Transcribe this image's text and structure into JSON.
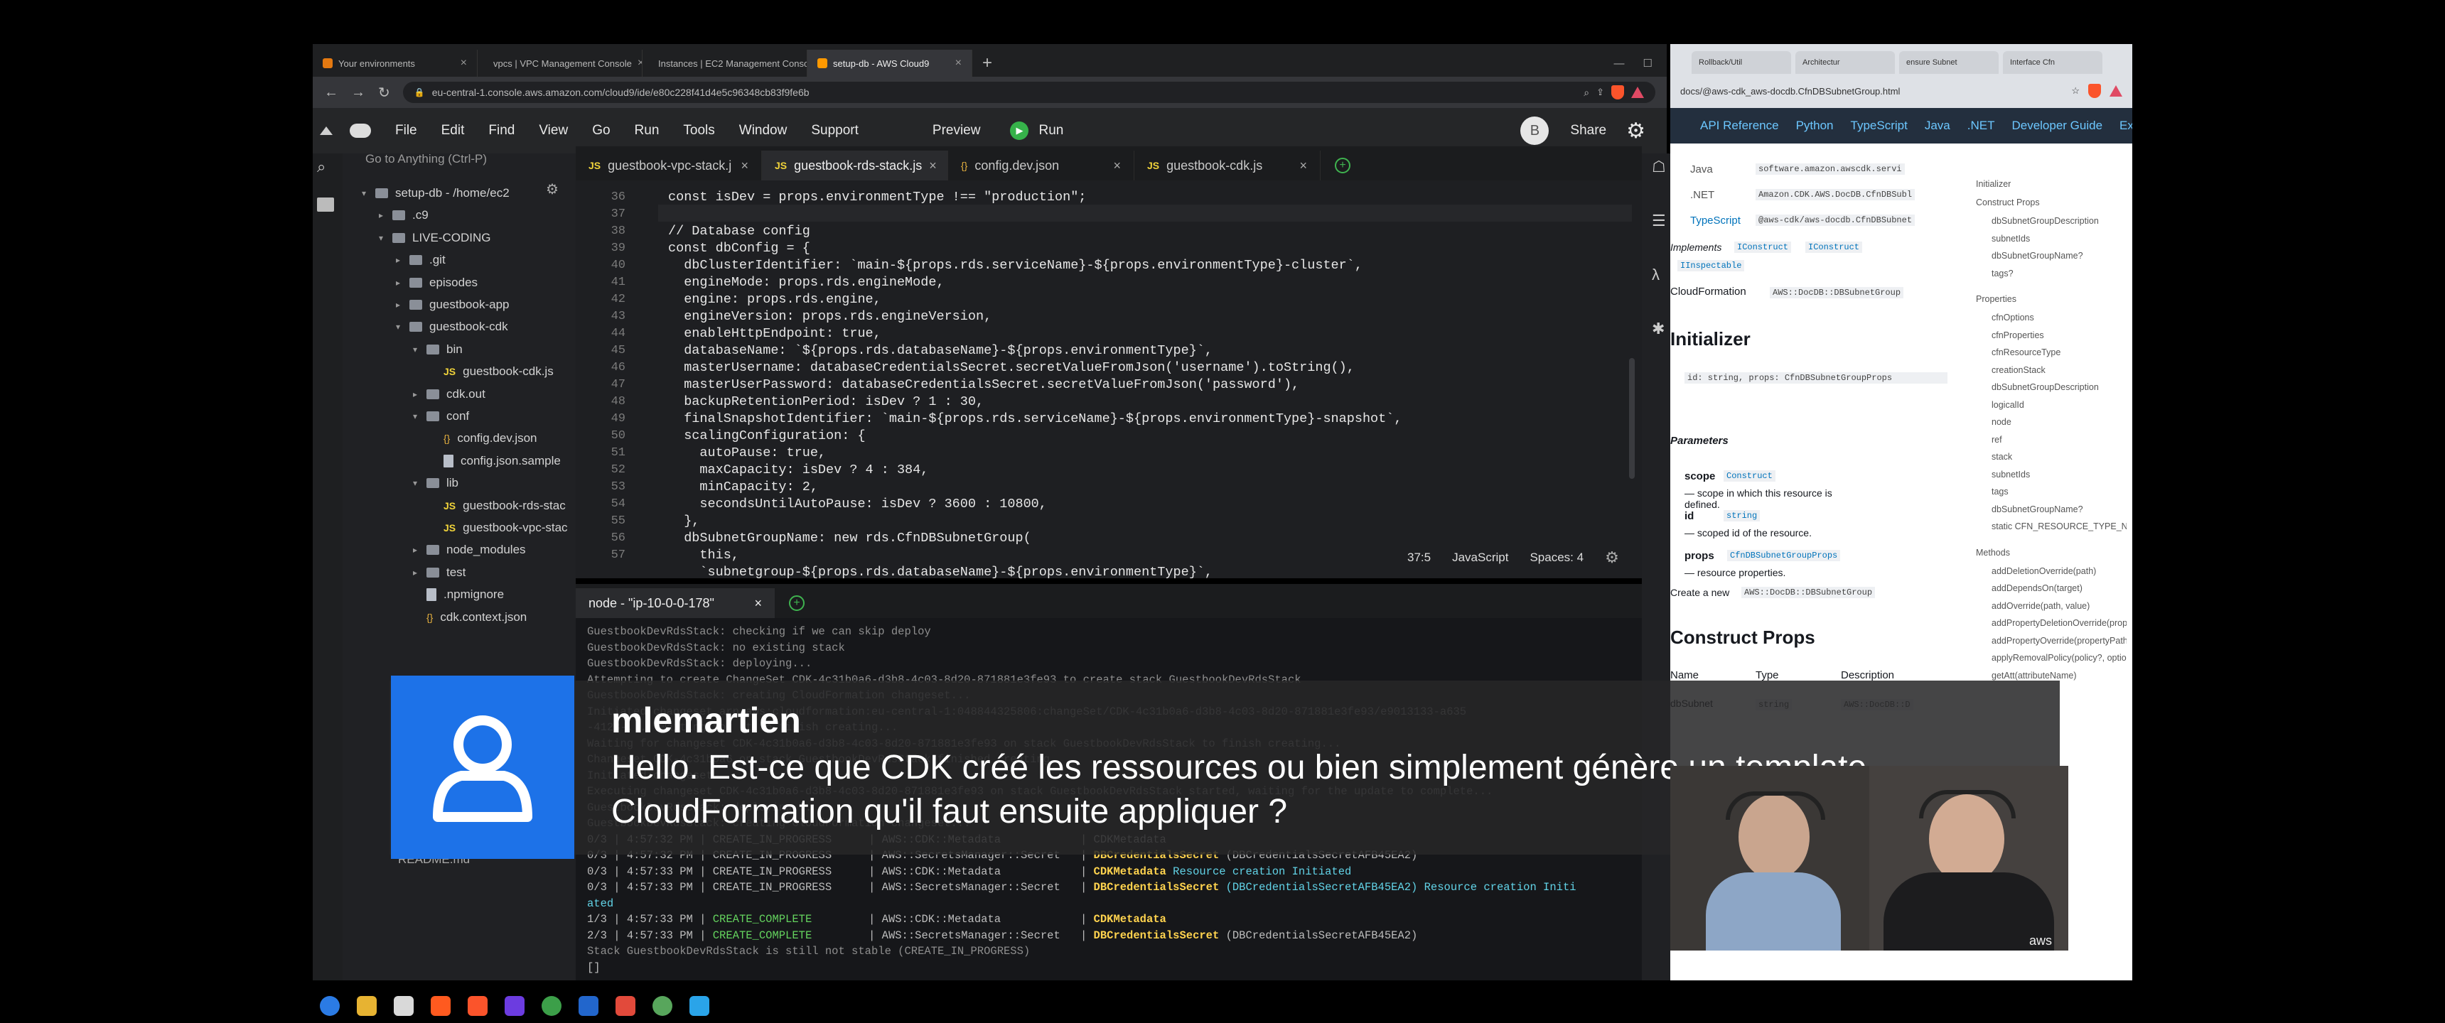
{
  "browser": {
    "tabs": [
      {
        "label": "Your environments",
        "active": false
      },
      {
        "label": "vpcs | VPC Management Console",
        "active": false
      },
      {
        "label": "Instances | EC2 Management Conso",
        "active": false
      },
      {
        "label": "setup-db - AWS Cloud9",
        "active": true
      }
    ],
    "url": "eu-central-1.console.aws.amazon.com/cloud9/ide/e80c228f41d4e5c96348cb83f9fe6b"
  },
  "c9": {
    "menu": [
      "File",
      "Edit",
      "Find",
      "View",
      "Go",
      "Run",
      "Tools",
      "Window",
      "Support"
    ],
    "preview": "Preview",
    "run": "Run",
    "user_initial": "B",
    "share": "Share"
  },
  "tree": {
    "goto_placeholder": "Go to Anything (Ctrl-P)",
    "items": [
      {
        "label": "setup-db - /home/ec2",
        "type": "folder",
        "depth": 0,
        "open": true
      },
      {
        "label": ".c9",
        "type": "folder",
        "depth": 1,
        "open": false
      },
      {
        "label": "LIVE-CODING",
        "type": "folder",
        "depth": 1,
        "open": true
      },
      {
        "label": ".git",
        "type": "folder",
        "depth": 2,
        "open": false
      },
      {
        "label": "episodes",
        "type": "folder",
        "depth": 2,
        "open": false
      },
      {
        "label": "guestbook-app",
        "type": "folder",
        "depth": 2,
        "open": false
      },
      {
        "label": "guestbook-cdk",
        "type": "folder",
        "depth": 2,
        "open": true
      },
      {
        "label": "bin",
        "type": "folder",
        "depth": 3,
        "open": true
      },
      {
        "label": "guestbook-cdk.js",
        "type": "js",
        "depth": 4
      },
      {
        "label": "cdk.out",
        "type": "folder",
        "depth": 3,
        "open": false
      },
      {
        "label": "conf",
        "type": "folder",
        "depth": 3,
        "open": true
      },
      {
        "label": "config.dev.json",
        "type": "json",
        "depth": 4
      },
      {
        "label": "config.json.sample",
        "type": "file",
        "depth": 4
      },
      {
        "label": "lib",
        "type": "folder",
        "depth": 3,
        "open": true
      },
      {
        "label": "guestbook-rds-stac",
        "type": "js",
        "depth": 4
      },
      {
        "label": "guestbook-vpc-stac",
        "type": "js",
        "depth": 4
      },
      {
        "label": "node_modules",
        "type": "folder",
        "depth": 3,
        "open": false
      },
      {
        "label": "test",
        "type": "folder",
        "depth": 3,
        "open": false
      },
      {
        "label": ".npmignore",
        "type": "file",
        "depth": 3
      },
      {
        "label": "cdk.context.json",
        "type": "json",
        "depth": 3
      }
    ],
    "bottom_item": "README.md"
  },
  "editor": {
    "tabs": [
      {
        "label": "guestbook-vpc-stack.j",
        "icon": "JS",
        "active": false
      },
      {
        "label": "guestbook-rds-stack.js",
        "icon": "JS",
        "active": true
      },
      {
        "label": "config.dev.json",
        "icon": "{}",
        "active": false
      },
      {
        "label": "guestbook-cdk.js",
        "icon": "JS",
        "active": false
      }
    ],
    "line_numbers": [
      "36",
      "37",
      "38",
      "39",
      "40",
      "41",
      "42",
      "43",
      "44",
      "45",
      "46",
      "47",
      "48",
      "49",
      "50",
      "51",
      "52",
      "53",
      "54",
      "55",
      "56",
      "57"
    ],
    "lines": [
      "const isDev = props.environmentType !== \"production\";",
      "",
      "// Database config",
      "const dbConfig = {",
      "  dbClusterIdentifier: `main-${props.rds.serviceName}-${props.environmentType}-cluster`,",
      "  engineMode: props.rds.engineMode,",
      "  engine: props.rds.engine,",
      "  engineVersion: props.rds.engineVersion,",
      "  enableHttpEndpoint: true,",
      "  databaseName: `${props.rds.databaseName}-${props.environmentType}`,",
      "  masterUsername: databaseCredentialsSecret.secretValueFromJson('username').toString(),",
      "  masterUserPassword: databaseCredentialsSecret.secretValueFromJson('password'),",
      "  backupRetentionPeriod: isDev ? 1 : 30,",
      "  finalSnapshotIdentifier: `main-${props.rds.serviceName}-${props.environmentType}-snapshot`,",
      "  scalingConfiguration: {",
      "    autoPause: true,",
      "    maxCapacity: isDev ? 4 : 384,",
      "    minCapacity: 2,",
      "    secondsUntilAutoPause: isDev ? 3600 : 10800,",
      "  },",
      "  dbSubnetGroupName: new rds.CfnDBSubnetGroup(",
      "    this,",
      "    `subnetgroup-${props.rds.databaseName}-${props.environmentType}`,"
    ],
    "status": {
      "position": "37:5",
      "language": "JavaScript",
      "spaces": "Spaces: 4"
    }
  },
  "terminal": {
    "tab": "node - \"ip-10-0-0-178\"",
    "lines": [
      {
        "text": "GuestbookDevRdsStack: checking if we can skip deploy",
        "cls": "tc-dim"
      },
      {
        "text": "GuestbookDevRdsStack: no existing stack",
        "cls": "tc-dim"
      },
      {
        "text": "GuestbookDevRdsStack: deploying...",
        "cls": "tc-dim"
      },
      {
        "text": "Attempting to create ChangeSet CDK-4c31b0a6-d3b8-4c03-8d20-871881e3fe93 to create stack GuestbookDevRdsStack",
        "cls": "tc-dim"
      },
      {
        "text": "GuestbookDevRdsStack: creating CloudFormation changeset...",
        "cls": "tc-dim"
      },
      {
        "text": "Initiated changeset arn:aws:cloudformation:eu-central-1:048844325806:changeSet/CDK-4c31b0a6-d3b8-4c03-8d20-871881e3fe93/e9013133-a635",
        "cls": "tc-dim"
      },
      {
        "text": "-4128-...  Waiting for it to finish creating...",
        "cls": "tc-dim"
      },
      {
        "text": "Waiting for changeset CDK-4c31b0a6-d3b8-4c03-8d20-871881e3fe93 on stack GuestbookDevRdsStack to finish creating...",
        "cls": "tc-dim"
      },
      {
        "text": "Changeset CDK-4c31b0a6 on stack GuestbookDevRdsStack finished creating",
        "cls": "tc-dim"
      },
      {
        "text": "Initiated changeset",
        "cls": "tc-dim"
      },
      {
        "text": "Executing changeset CDK-4c31b0a6-d3b8-4c03-8d20-871881e3fe93 on stack GuestbookDevRdsStack started, waiting for the update to complete...",
        "cls": "tc-dim"
      },
      {
        "text": "GuestbookDevRdsStack: deploying...",
        "cls": "tc-dim"
      },
      {
        "text": "GuestbookDevRdsStack: creating CloudFormation changeset...",
        "cls": "tc-dim"
      }
    ],
    "events": [
      {
        "count": "0/3",
        "time": "4:57:32 PM",
        "status": "CREATE_IN_PROGRESS",
        "type": "AWS::CDK::Metadata",
        "id": "CDKMetadata",
        "extra": "",
        "status_cls": "",
        "id_cls": ""
      },
      {
        "count": "0/3",
        "time": "4:57:32 PM",
        "status": "CREATE_IN_PROGRESS",
        "type": "AWS::SecretsManager::Secret",
        "id": "DBCredentialsSecret",
        "extra": " (DBCredentialsSecretAFB45EA2)",
        "status_cls": "",
        "id_cls": "tc-yellow"
      },
      {
        "count": "0/3",
        "time": "4:57:33 PM",
        "status": "CREATE_IN_PROGRESS",
        "type": "AWS::CDK::Metadata",
        "id": "CDKMetadata",
        "extra": " Resource creation Initiated",
        "status_cls": "",
        "id_cls": "tc-yellow"
      },
      {
        "count": "0/3",
        "time": "4:57:33 PM",
        "status": "CREATE_IN_PROGRESS",
        "type": "AWS::SecretsManager::Secret",
        "id": "DBCredentialsSecret",
        "extra": " (DBCredentialsSecretAFB45EA2) Resource creation Initi",
        "status_cls": "",
        "id_cls": "tc-yellow"
      },
      {
        "count": "",
        "time": "",
        "status": "",
        "type": "",
        "id": "",
        "extra": "ated",
        "status_cls": "",
        "id_cls": ""
      },
      {
        "count": "1/3",
        "time": "4:57:33 PM",
        "status": "CREATE_COMPLETE",
        "type": "AWS::CDK::Metadata",
        "id": "CDKMetadata",
        "extra": "",
        "status_cls": "tc-green",
        "id_cls": "tc-yellow"
      },
      {
        "count": "2/3",
        "time": "4:57:33 PM",
        "status": "CREATE_COMPLETE",
        "type": "AWS::SecretsManager::Secret",
        "id": "DBCredentialsSecret",
        "extra": " (DBCredentialsSecretAFB45EA2)",
        "status_cls": "tc-green",
        "id_cls": "tc-yellow"
      }
    ],
    "footer": "Stack GuestbookDevRdsStack is still not stable (CREATE_IN_PROGRESS)",
    "prompt": "[]"
  },
  "docs": {
    "tabs": [
      "Rollback/Util",
      "Architectur",
      "ensure Subnet",
      "Interface Cfn"
    ],
    "url": "docs/@aws-cdk_aws-docdb.CfnDBSubnetGroup.html",
    "nav": [
      "API Reference",
      "Python",
      "TypeScript",
      "Java",
      ".NET",
      "Developer Guide",
      "Examp"
    ],
    "lang_rows": [
      {
        "lang": "Java",
        "pkg": "software.amazon.awscdk.servi"
      },
      {
        "lang": ".NET",
        "pkg": "Amazon.CDK.AWS.DocDB.CfnDBSubl"
      },
      {
        "lang": "TypeScript",
        "pkg": "@aws-cdk/aws-docdb.CfnDBSubnet"
      }
    ],
    "implements_label": "Implements",
    "implements": [
      "IConstruct",
      "IConstruct",
      "IInspectable"
    ],
    "cfn_label": "CloudFormation",
    "cfn_value": "AWS::DocDB::DBSubnetGroup",
    "initializer_title": "Initializer",
    "initializer_sig": "id: string, props: CfnDBSubnetGroupProps",
    "parameters_title": "Parameters",
    "params": [
      {
        "name": "scope",
        "type": "Construct",
        "desc": "— scope in which this resource is defined."
      },
      {
        "name": "id",
        "type": "string",
        "desc": "— scoped id of the resource."
      },
      {
        "name": "props",
        "type": "CfnDBSubnetGroupProps",
        "desc": "— resource properties."
      }
    ],
    "create_text": "Create a new",
    "create_value": "AWS::DocDB::DBSubnetGroup",
    "construct_props_title": "Construct Props",
    "table_headers": [
      "Name",
      "Type",
      "Description"
    ],
    "table_row": {
      "name": "dbSubnet",
      "type": "string",
      "desc": "AWS::DocDB::D"
    },
    "footer": "SubnetGroupDescription",
    "toc": {
      "top": "Initializer",
      "sections": [
        {
          "title": "Construct Props",
          "items": [
            "dbSubnetGroupDescription",
            "subnetIds",
            "dbSubnetGroupName?",
            "tags?"
          ]
        },
        {
          "title": "Properties",
          "items": [
            "cfnOptions",
            "cfnProperties",
            "cfnResourceType",
            "creationStack",
            "dbSubnetGroupDescription",
            "logicalId",
            "node",
            "ref",
            "stack",
            "subnetIds",
            "tags",
            "dbSubnetGroupName?",
            "static CFN_RESOURCE_TYPE_NAME"
          ]
        },
        {
          "title": "Methods",
          "items": [
            "addDeletionOverride(path)",
            "addDependsOn(target)",
            "addOverride(path, value)",
            "addPropertyDeletionOverride(propertyPath)",
            "addPropertyOverride(propertyPath, value)",
            "applyRemovalPolicy(policy?, options?)",
            "getAtt(attributeName)"
          ]
        }
      ]
    }
  },
  "overlay": {
    "username": "mlemartien",
    "message": "Hello. Est-ce que CDK créé les ressources ou bien simplement génère un template CloudFormation qu'il faut ensuite appliquer ?"
  },
  "video": {
    "watermark": "aws"
  },
  "colors": {
    "accent_run": "#36b24a",
    "avatar_bg": "#1d72e8",
    "status_complete": "#64d35e",
    "resource_id": "#ffd34e"
  }
}
